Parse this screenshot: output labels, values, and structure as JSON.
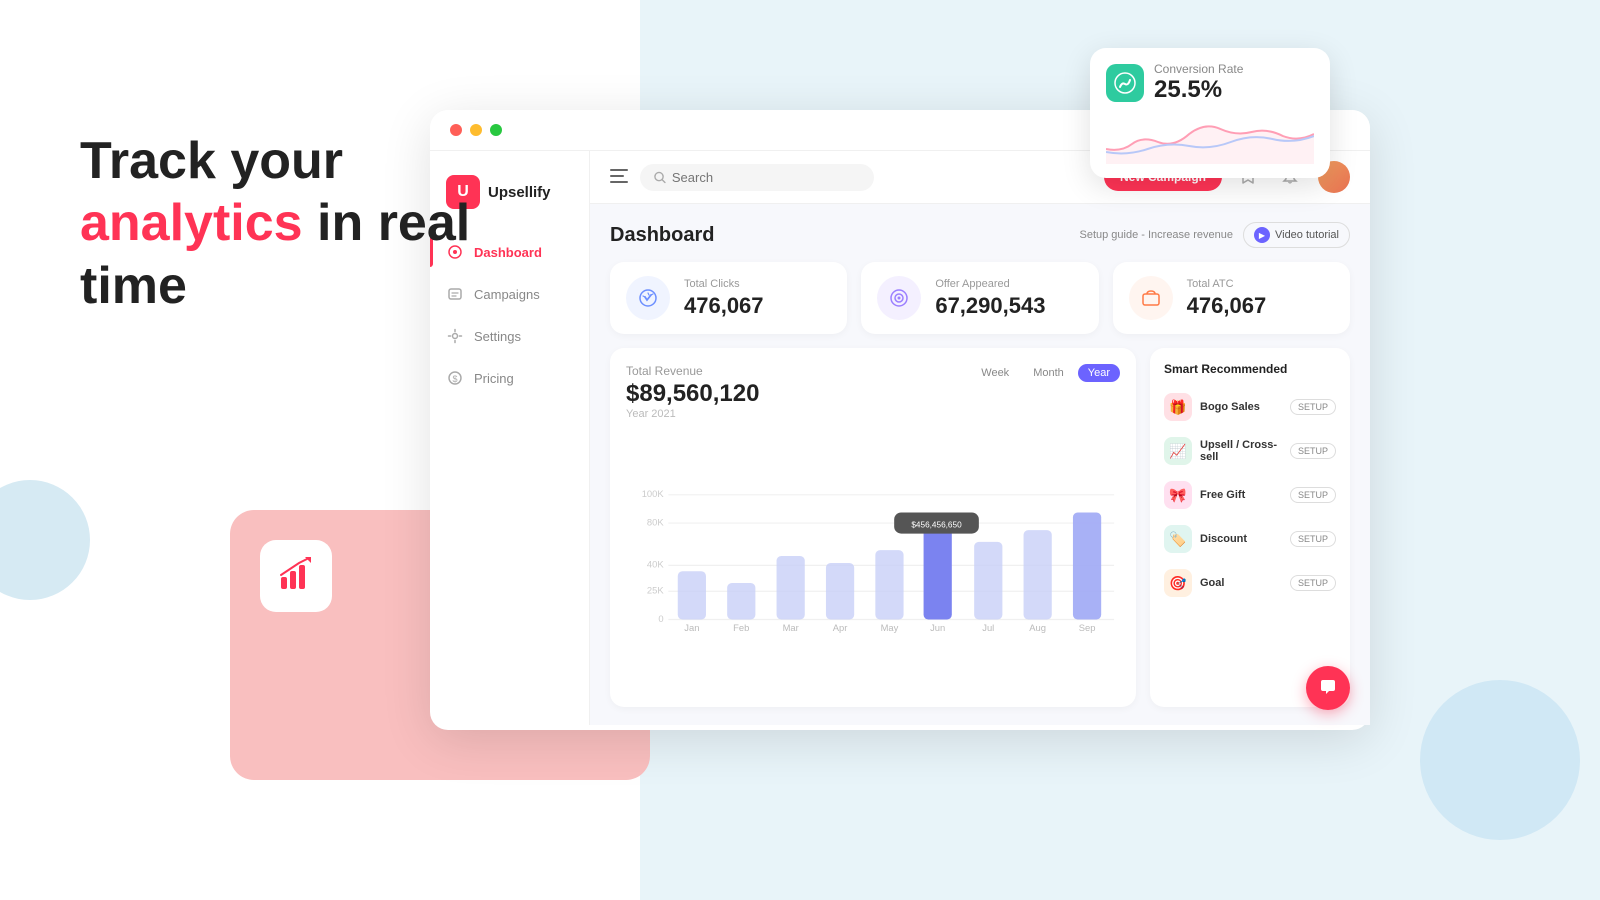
{
  "page": {
    "bg_left": "#ffffff",
    "bg_right": "#e8f4f9"
  },
  "hero": {
    "line1": "Track your",
    "highlight": "analytics",
    "line2": " in real",
    "line3": "time"
  },
  "browser": {
    "dots": [
      "red",
      "yellow",
      "green"
    ]
  },
  "sidebar": {
    "logo": "U",
    "brand": "Upsellify",
    "items": [
      {
        "label": "Dashboard",
        "active": true
      },
      {
        "label": "Campaigns",
        "active": false
      },
      {
        "label": "Settings",
        "active": false
      },
      {
        "label": "Pricing",
        "active": false
      }
    ]
  },
  "header": {
    "search_placeholder": "Search",
    "new_campaign_label": "New Campaign"
  },
  "dashboard": {
    "title": "Dashboard",
    "setup_guide": "Setup guide - Increase revenue",
    "video_btn": "Video tutorial"
  },
  "stats": [
    {
      "label": "Total Clicks",
      "value": "476,067",
      "icon_type": "blue"
    },
    {
      "label": "Offer Appeared",
      "value": "67,290,543",
      "icon_type": "purple"
    },
    {
      "label": "Total ATC",
      "value": "476,067",
      "icon_type": "orange"
    }
  ],
  "revenue": {
    "title": "Total Revenue",
    "amount": "$89,560,120",
    "year": "Year 2021",
    "tabs": [
      {
        "label": "Week",
        "active": false
      },
      {
        "label": "Month",
        "active": false
      },
      {
        "label": "Year",
        "active": true
      }
    ]
  },
  "chart": {
    "months": [
      "Jan",
      "Feb",
      "Mar",
      "Apr",
      "May",
      "Jun",
      "Jul",
      "Aug",
      "Sep"
    ],
    "values": [
      35,
      25,
      45,
      40,
      50,
      70,
      55,
      65,
      80
    ],
    "tooltip_month": "Jun",
    "tooltip_value": "$456,456,650",
    "y_labels": [
      "100K",
      "80K",
      "40K",
      "25K",
      "0"
    ]
  },
  "smart_recommended": {
    "title": "Smart Recommended",
    "items": [
      {
        "label": "Bogo Sales",
        "icon": "🎁",
        "color": "red",
        "btn": "SETUP"
      },
      {
        "label": "Upsell / Cross-sell",
        "icon": "📈",
        "color": "green",
        "btn": "SETUP"
      },
      {
        "label": "Free Gift",
        "icon": "🎀",
        "color": "pink",
        "btn": "SETUP"
      },
      {
        "label": "Discount",
        "icon": "🏷️",
        "color": "teal",
        "btn": "SETUP"
      },
      {
        "label": "Goal",
        "icon": "🎯",
        "color": "orange",
        "btn": "SETUP"
      }
    ]
  },
  "conversion": {
    "label": "Conversion Rate",
    "value": "25.5%",
    "icon": "📊"
  },
  "chat_btn": "💬"
}
